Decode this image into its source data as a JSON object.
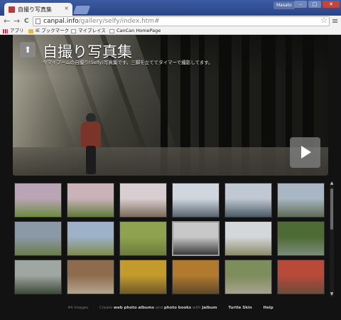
{
  "browser": {
    "tab_title": "自撮り写真集",
    "tab_close": "×",
    "profile": "Masato",
    "window_buttons": [
      "–",
      "□",
      "✕"
    ],
    "url_host": "canpal.info",
    "url_path": "/gallery/selfy/index.htm#",
    "back": "←",
    "forward": "→",
    "reload": "C",
    "star": "☆",
    "menu": "≡",
    "bookmarks": [
      {
        "label": "アプリ",
        "icon": "apps-icon"
      },
      {
        "label": "IE ブックマーク",
        "icon": "folder-icon"
      },
      {
        "label": "マイプレイス",
        "icon": "page-icon"
      },
      {
        "label": "CanCan HomePage",
        "icon": "page-icon"
      }
    ]
  },
  "gallery": {
    "home_icon": "⬆",
    "title": "自撮り写真集",
    "caption": "今マイブームの自撮り(Selfy)写真集です。三脚を立ててタイマーで撮影してます。",
    "scroll_up": "▲",
    "scroll_down": "▼",
    "thumbnails": [
      {
        "colors": [
          "#b9a5b5",
          "#6b8b3f"
        ]
      },
      {
        "colors": [
          "#c9b2b8",
          "#5f7a3a"
        ]
      },
      {
        "colors": [
          "#d8cdd1",
          "#7c6a5a"
        ]
      },
      {
        "colors": [
          "#cfd6de",
          "#58656f"
        ]
      },
      {
        "colors": [
          "#bfc8d3",
          "#4c5b66"
        ]
      },
      {
        "colors": [
          "#a8b7c3",
          "#5e6b55"
        ]
      },
      {
        "colors": [
          "#8b98a6",
          "#6a7d4a"
        ]
      },
      {
        "colors": [
          "#9db1c8",
          "#7f8a4d"
        ]
      },
      {
        "colors": [
          "#8fa24f",
          "#6b7c3d"
        ]
      },
      {
        "colors": [
          "#c8c8c8",
          "#3a3a3a"
        ]
      },
      {
        "colors": [
          "#d3d7d9",
          "#8b8b6a"
        ]
      },
      {
        "colors": [
          "#4d6b35",
          "#7b8b7a"
        ]
      },
      {
        "colors": [
          "#9ea7a1",
          "#3f4a3a"
        ]
      },
      {
        "colors": [
          "#8f6b4d",
          "#b4a58f"
        ]
      },
      {
        "colors": [
          "#c39a2c",
          "#6d5a2a"
        ]
      },
      {
        "colors": [
          "#b27a2f",
          "#5e4a2a"
        ]
      },
      {
        "colors": [
          "#7d8d5c",
          "#a7a28f"
        ]
      },
      {
        "colors": [
          "#b94a3a",
          "#6a4b3a"
        ]
      }
    ]
  },
  "footer": {
    "count": "44 images",
    "credit_prefix": "Create",
    "credit_a": "web photo albums",
    "credit_mid": "and",
    "credit_b": "photo books",
    "credit_with": "with",
    "credit_brand": "Jalbum",
    "skin": "Turtle Skin",
    "help": "Help"
  }
}
